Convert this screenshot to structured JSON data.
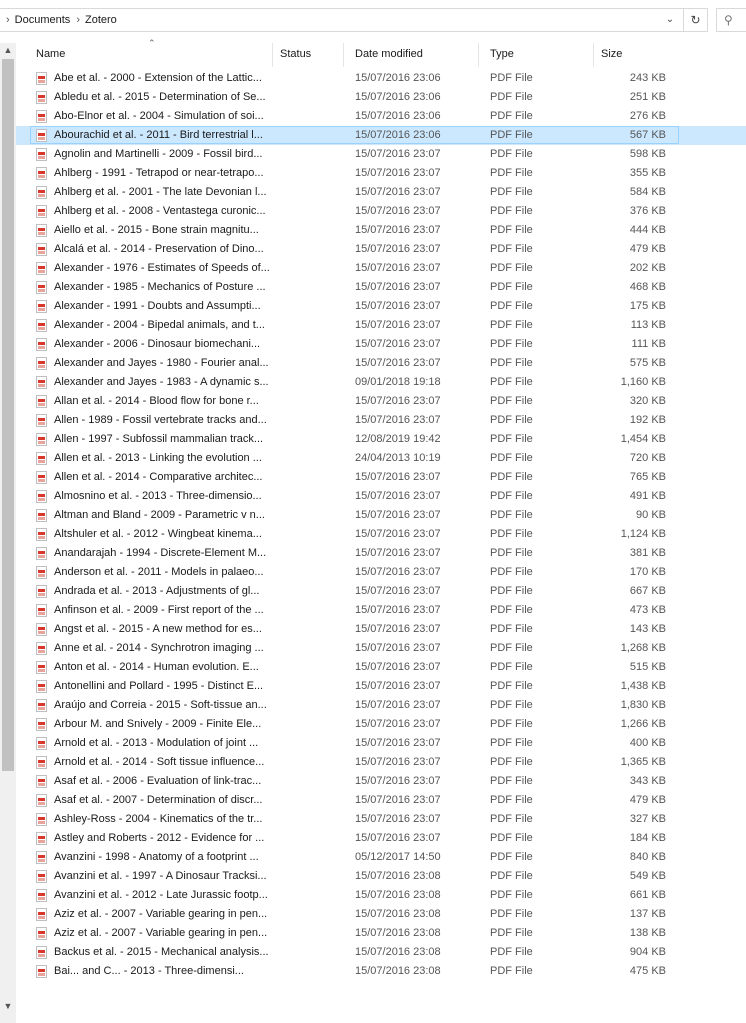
{
  "address": {
    "breadcrumbs": [
      "Documents",
      "Zotero"
    ],
    "dropdown_icon": "chevron-down-icon",
    "refresh_icon": "refresh-icon",
    "search_icon": "search-icon"
  },
  "columns": {
    "name": "Name",
    "status": "Status",
    "date": "Date modified",
    "type": "Type",
    "size": "Size"
  },
  "files": [
    {
      "name": "Abe et al. - 2000 - Extension of the Lattic...",
      "date": "15/07/2016 23:06",
      "type": "PDF File",
      "size": "243 KB"
    },
    {
      "name": "Abledu et al. - 2015 - Determination of Se...",
      "date": "15/07/2016 23:06",
      "type": "PDF File",
      "size": "251 KB"
    },
    {
      "name": "Abo-Elnor et al. - 2004 - Simulation of soi...",
      "date": "15/07/2016 23:06",
      "type": "PDF File",
      "size": "276 KB"
    },
    {
      "name": "Abourachid et al. - 2011 - Bird terrestrial l...",
      "date": "15/07/2016 23:06",
      "type": "PDF File",
      "size": "567 KB",
      "selected": true
    },
    {
      "name": "Agnolin and Martinelli - 2009 - Fossil bird...",
      "date": "15/07/2016 23:07",
      "type": "PDF File",
      "size": "598 KB"
    },
    {
      "name": "Ahlberg - 1991 - Tetrapod or near-tetrapo...",
      "date": "15/07/2016 23:07",
      "type": "PDF File",
      "size": "355 KB"
    },
    {
      "name": "Ahlberg et al. - 2001 - The late Devonian l...",
      "date": "15/07/2016 23:07",
      "type": "PDF File",
      "size": "584 KB"
    },
    {
      "name": "Ahlberg et al. - 2008 - Ventastega curonic...",
      "date": "15/07/2016 23:07",
      "type": "PDF File",
      "size": "376 KB"
    },
    {
      "name": "Aiello et al. - 2015 - Bone strain magnitu...",
      "date": "15/07/2016 23:07",
      "type": "PDF File",
      "size": "444 KB"
    },
    {
      "name": "Alcalá et al. - 2014 - Preservation of Dino...",
      "date": "15/07/2016 23:07",
      "type": "PDF File",
      "size": "479 KB"
    },
    {
      "name": "Alexander - 1976 - Estimates of Speeds of...",
      "date": "15/07/2016 23:07",
      "type": "PDF File",
      "size": "202 KB"
    },
    {
      "name": "Alexander - 1985 - Mechanics of Posture ...",
      "date": "15/07/2016 23:07",
      "type": "PDF File",
      "size": "468 KB"
    },
    {
      "name": "Alexander - 1991 - Doubts and Assumpti...",
      "date": "15/07/2016 23:07",
      "type": "PDF File",
      "size": "175 KB"
    },
    {
      "name": "Alexander - 2004 - Bipedal animals, and t...",
      "date": "15/07/2016 23:07",
      "type": "PDF File",
      "size": "113 KB"
    },
    {
      "name": "Alexander - 2006 - Dinosaur biomechani...",
      "date": "15/07/2016 23:07",
      "type": "PDF File",
      "size": "111 KB"
    },
    {
      "name": "Alexander and Jayes - 1980 - Fourier anal...",
      "date": "15/07/2016 23:07",
      "type": "PDF File",
      "size": "575 KB"
    },
    {
      "name": "Alexander and Jayes - 1983 - A dynamic s...",
      "date": "09/01/2018 19:18",
      "type": "PDF File",
      "size": "1,160 KB"
    },
    {
      "name": "Allan et al. - 2014 - Blood flow for bone r...",
      "date": "15/07/2016 23:07",
      "type": "PDF File",
      "size": "320 KB"
    },
    {
      "name": "Allen - 1989 - Fossil vertebrate tracks and...",
      "date": "15/07/2016 23:07",
      "type": "PDF File",
      "size": "192 KB"
    },
    {
      "name": "Allen - 1997 - Subfossil mammalian track...",
      "date": "12/08/2019 19:42",
      "type": "PDF File",
      "size": "1,454 KB"
    },
    {
      "name": "Allen et al. - 2013 - Linking the evolution ...",
      "date": "24/04/2013 10:19",
      "type": "PDF File",
      "size": "720 KB"
    },
    {
      "name": "Allen et al. - 2014 - Comparative architec...",
      "date": "15/07/2016 23:07",
      "type": "PDF File",
      "size": "765 KB"
    },
    {
      "name": "Almosnino et al. - 2013 - Three-dimensio...",
      "date": "15/07/2016 23:07",
      "type": "PDF File",
      "size": "491 KB"
    },
    {
      "name": "Altman and Bland - 2009 - Parametric v n...",
      "date": "15/07/2016 23:07",
      "type": "PDF File",
      "size": "90 KB"
    },
    {
      "name": "Altshuler et al. - 2012 - Wingbeat kinema...",
      "date": "15/07/2016 23:07",
      "type": "PDF File",
      "size": "1,124 KB"
    },
    {
      "name": "Anandarajah - 1994 - Discrete-Element M...",
      "date": "15/07/2016 23:07",
      "type": "PDF File",
      "size": "381 KB"
    },
    {
      "name": "Anderson et al. - 2011 - Models in palaeo...",
      "date": "15/07/2016 23:07",
      "type": "PDF File",
      "size": "170 KB"
    },
    {
      "name": "Andrada et al. - 2013 - Adjustments of gl...",
      "date": "15/07/2016 23:07",
      "type": "PDF File",
      "size": "667 KB"
    },
    {
      "name": "Anfinson et al. - 2009 - First report of the ...",
      "date": "15/07/2016 23:07",
      "type": "PDF File",
      "size": "473 KB"
    },
    {
      "name": "Angst et al. - 2015 - A new method for es...",
      "date": "15/07/2016 23:07",
      "type": "PDF File",
      "size": "143 KB"
    },
    {
      "name": "Anne et al. - 2014 - Synchrotron imaging ...",
      "date": "15/07/2016 23:07",
      "type": "PDF File",
      "size": "1,268 KB"
    },
    {
      "name": "Anton et al. - 2014 - Human evolution. E...",
      "date": "15/07/2016 23:07",
      "type": "PDF File",
      "size": "515 KB"
    },
    {
      "name": "Antonellini and Pollard - 1995 - Distinct E...",
      "date": "15/07/2016 23:07",
      "type": "PDF File",
      "size": "1,438 KB"
    },
    {
      "name": "Araújo and Correia - 2015 - Soft-tissue an...",
      "date": "15/07/2016 23:07",
      "type": "PDF File",
      "size": "1,830 KB"
    },
    {
      "name": "Arbour M. and Snively - 2009 - Finite Ele...",
      "date": "15/07/2016 23:07",
      "type": "PDF File",
      "size": "1,266 KB"
    },
    {
      "name": "Arnold et al. - 2013 - Modulation of joint ...",
      "date": "15/07/2016 23:07",
      "type": "PDF File",
      "size": "400 KB"
    },
    {
      "name": "Arnold et al. - 2014 - Soft tissue influence...",
      "date": "15/07/2016 23:07",
      "type": "PDF File",
      "size": "1,365 KB"
    },
    {
      "name": "Asaf et al. - 2006 - Evaluation of link-trac...",
      "date": "15/07/2016 23:07",
      "type": "PDF File",
      "size": "343 KB"
    },
    {
      "name": "Asaf et al. - 2007 - Determination of discr...",
      "date": "15/07/2016 23:07",
      "type": "PDF File",
      "size": "479 KB"
    },
    {
      "name": "Ashley-Ross - 2004 - Kinematics of the tr...",
      "date": "15/07/2016 23:07",
      "type": "PDF File",
      "size": "327 KB"
    },
    {
      "name": "Astley and Roberts - 2012 - Evidence for ...",
      "date": "15/07/2016 23:07",
      "type": "PDF File",
      "size": "184 KB"
    },
    {
      "name": "Avanzini - 1998 - Anatomy of a footprint ...",
      "date": "05/12/2017 14:50",
      "type": "PDF File",
      "size": "840 KB"
    },
    {
      "name": "Avanzini et al. - 1997 - A Dinosaur Tracksi...",
      "date": "15/07/2016 23:08",
      "type": "PDF File",
      "size": "549 KB"
    },
    {
      "name": "Avanzini et al. - 2012 - Late Jurassic footp...",
      "date": "15/07/2016 23:08",
      "type": "PDF File",
      "size": "661 KB"
    },
    {
      "name": "Aziz et al. - 2007 - Variable gearing in pen...",
      "date": "15/07/2016 23:08",
      "type": "PDF File",
      "size": "137 KB"
    },
    {
      "name": "Aziz et al. - 2007 - Variable gearing in pen...",
      "date": "15/07/2016 23:08",
      "type": "PDF File",
      "size": "138 KB"
    },
    {
      "name": "Backus et al. - 2015 - Mechanical analysis...",
      "date": "15/07/2016 23:08",
      "type": "PDF File",
      "size": "904 KB"
    },
    {
      "name": "Bai... and C... - 2013 - Three-dimensi...",
      "date": "15/07/2016 23:08",
      "type": "PDF File",
      "size": "475 KB"
    }
  ]
}
